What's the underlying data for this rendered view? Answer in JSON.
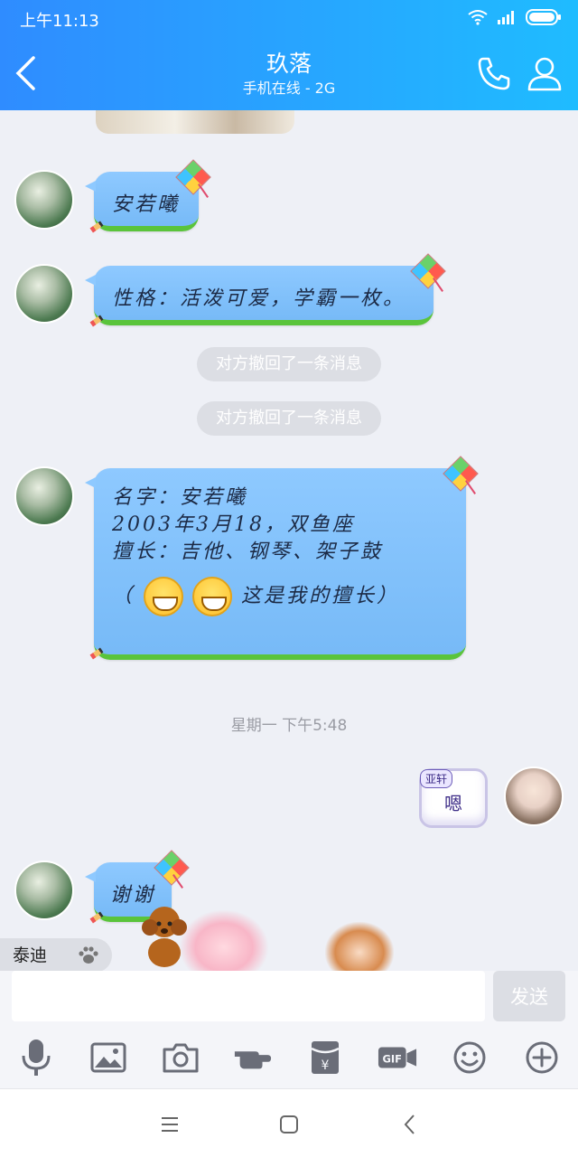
{
  "status": {
    "time": "上午11:13"
  },
  "header": {
    "title": "玖落",
    "subtitle": "手机在线 - 2G"
  },
  "messages": [
    {
      "side": "left",
      "text": "安若曦"
    },
    {
      "side": "left",
      "text": "性格：活泼可爱，学霸一枚。"
    },
    {
      "type": "system",
      "text": "对方撤回了一条消息"
    },
    {
      "type": "system",
      "text": "对方撤回了一条消息"
    },
    {
      "side": "left",
      "lines": [
        "名字：安若曦",
        "2003年3月18，双鱼座",
        "擅长：吉他、钢琴、架子鼓",
        "这是我的擅长）"
      ],
      "prefix": "（"
    },
    {
      "type": "time",
      "text": "星期一 下午5:48"
    },
    {
      "side": "right",
      "tag": "亚轩",
      "text": "嗯"
    },
    {
      "side": "left",
      "text": "谢谢"
    }
  ],
  "nickname": "泰迪",
  "input": {
    "placeholder": "",
    "send_label": "发送"
  },
  "toolbar": [
    "voice-icon",
    "image-icon",
    "camera-icon",
    "hand-icon",
    "red-packet-icon",
    "gif-icon",
    "emoji-icon",
    "plus-icon"
  ],
  "colors": {
    "header_start": "#2f8cff",
    "header_end": "#1fbcff",
    "bubble": "#8ec9ff",
    "bubble_border": "#5ac43b"
  }
}
